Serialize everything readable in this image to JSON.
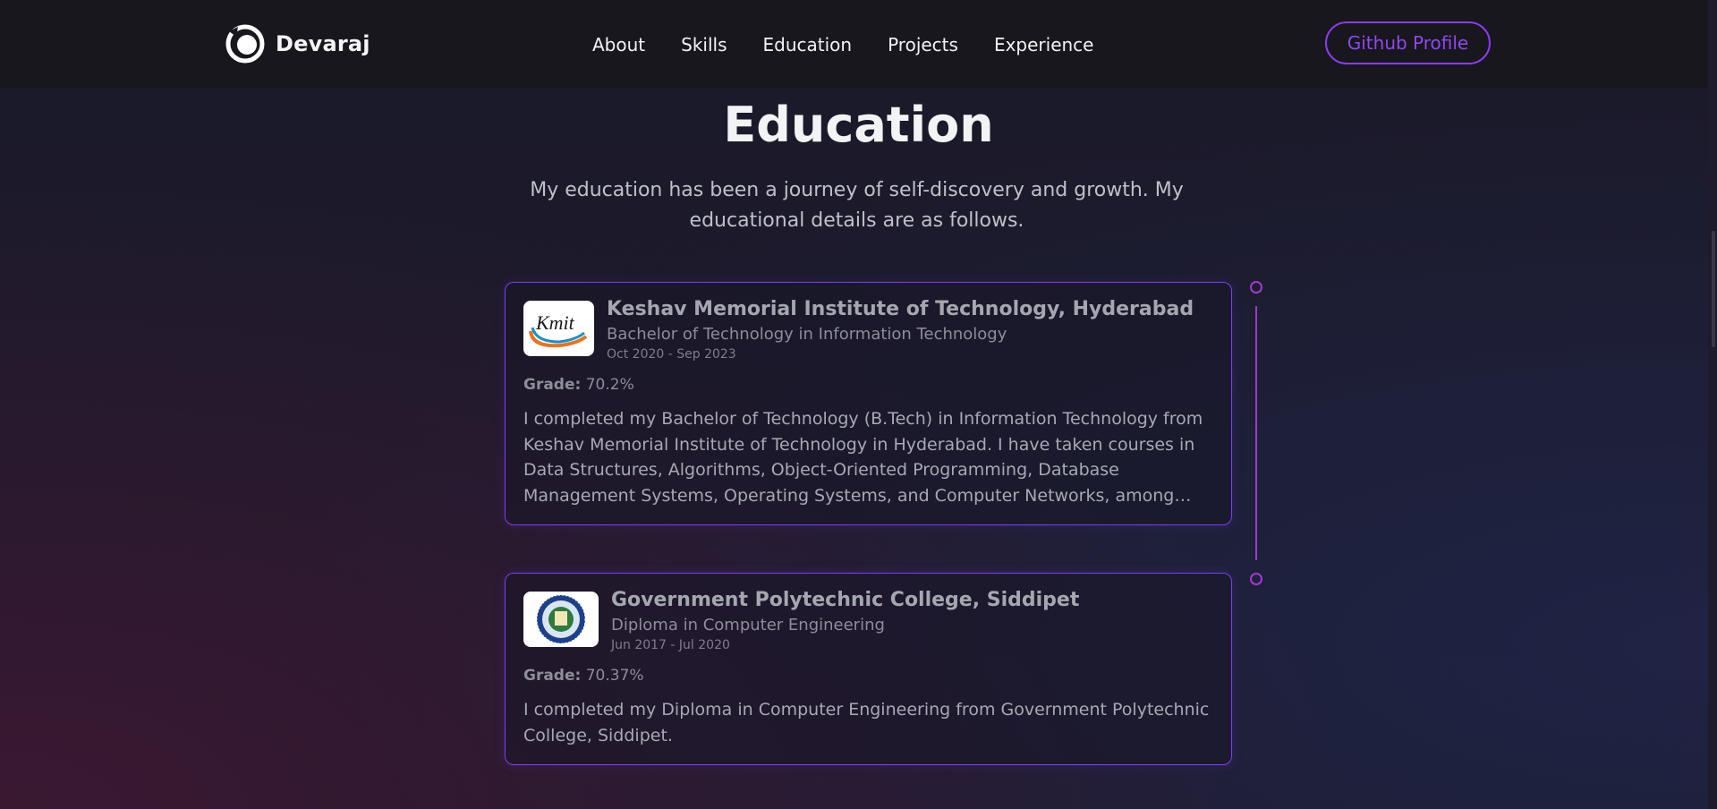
{
  "brand": {
    "name": "Devaraj",
    "icon": "circle-logo-icon"
  },
  "nav": {
    "links": [
      "About",
      "Skills",
      "Education",
      "Projects",
      "Experience"
    ],
    "github_button": "Github Profile"
  },
  "section": {
    "title": "Education",
    "subtitle": "My education has been a journey of self-discovery and growth. My educational details are as follows."
  },
  "education": [
    {
      "school": "Keshav Memorial Institute of Technology, Hyderabad",
      "degree": "Bachelor of Technology in Information Technology",
      "dates": "Oct 2020 - Sep 2023",
      "grade_label": "Grade:",
      "grade": "70.2%",
      "logo_text": "Kmit",
      "description": "I completed my Bachelor of Technology (B.Tech) in Information Technology from Keshav Memorial Institute of Technology in Hyderabad. I have taken courses in Data Structures, Algorithms, Object-Oriented Programming, Database Management Systems, Operating Systems, and Computer Networks, among others."
    },
    {
      "school": "Government Polytechnic College, Siddipet",
      "degree": "Diploma in Computer Engineering",
      "dates": "Jun 2017 - Jul 2020",
      "grade_label": "Grade:",
      "grade": "70.37%",
      "description": "I completed my Diploma in Computer Engineering from Government Polytechnic College, Siddipet."
    }
  ],
  "colors": {
    "accent": "#8a3cf0",
    "timeline": "#a23cc9",
    "nav_bg": "#17171d"
  }
}
